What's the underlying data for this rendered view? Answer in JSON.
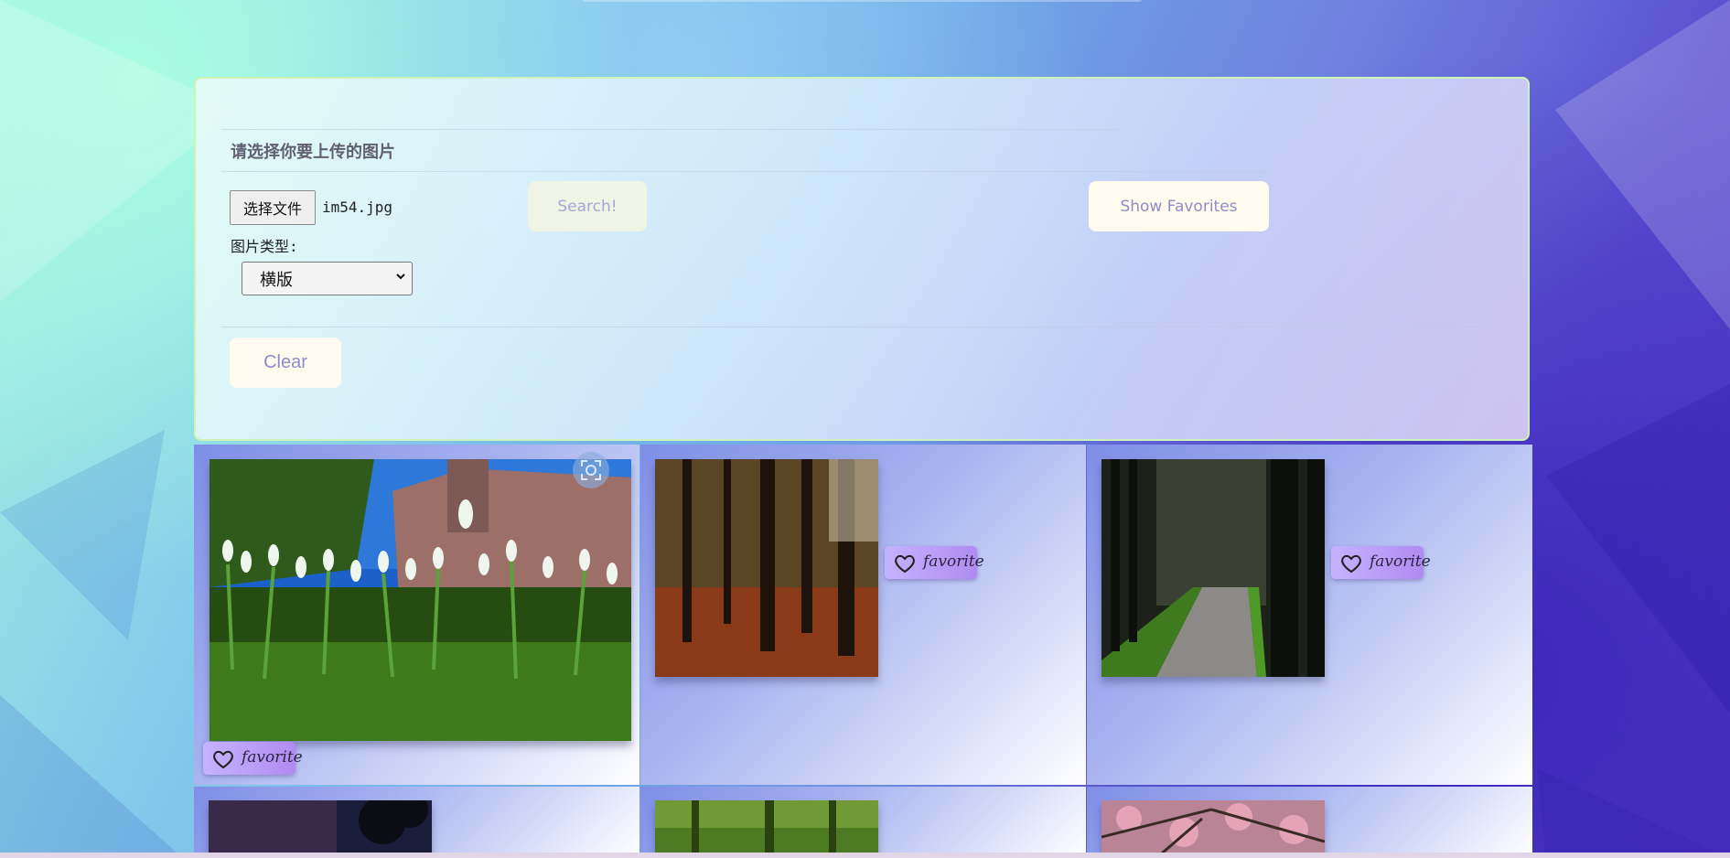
{
  "upload": {
    "title": "请选择你要上传的图片",
    "file_button": "选择文件",
    "file_name": "im54.jpg",
    "type_label": "图片类型:",
    "type_selected": "横版"
  },
  "buttons": {
    "search": "Search!",
    "show_favorites": "Show Favorites",
    "clear": "Clear"
  },
  "gallery": {
    "favorite_label": "favorite",
    "items": [
      {
        "scene": "snowdrops-church"
      },
      {
        "scene": "autumn-forest"
      },
      {
        "scene": "tree-lined-path"
      },
      {
        "scene": "dark-tree-silhouette"
      },
      {
        "scene": "green-forest"
      },
      {
        "scene": "pink-blossom"
      }
    ]
  },
  "icons": [
    "file-chooser-icon",
    "chevron-down-icon",
    "scan-icon",
    "heart-icon"
  ],
  "colors": {
    "panel_border": "#cdf3b9",
    "button_bg": "#fffbee",
    "button_text": "#8f8cc8",
    "favorite_tag": "#b08bf1"
  }
}
